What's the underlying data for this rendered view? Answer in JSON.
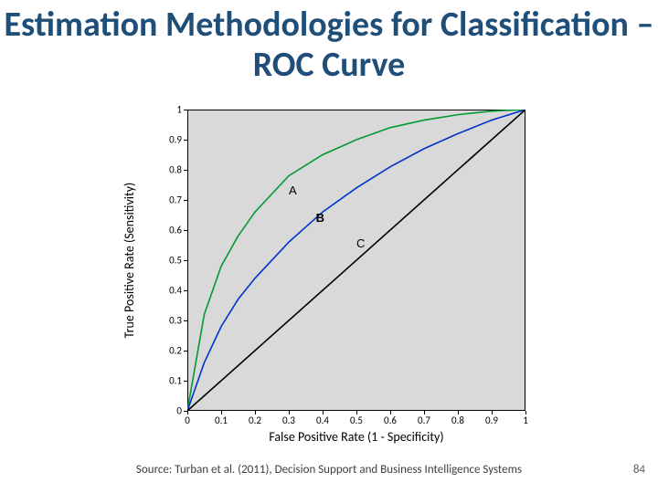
{
  "title": "Estimation Methodologies for Classification – ROC Curve",
  "source": "Source: Turban et al. (2011), Decision Support and Business Intelligence Systems",
  "page_number": "84",
  "chart_data": {
    "type": "line",
    "title": "",
    "xlabel": "False Positive Rate (1 - Specificity)",
    "ylabel": "True Positive Rate (Sensitivity)",
    "xlim": [
      0,
      1
    ],
    "ylim": [
      0,
      1
    ],
    "xticks": [
      0,
      0.1,
      0.2,
      0.3,
      0.4,
      0.5,
      0.6,
      0.7,
      0.8,
      0.9,
      1
    ],
    "yticks": [
      0,
      0.1,
      0.2,
      0.3,
      0.4,
      0.5,
      0.6,
      0.7,
      0.8,
      0.9,
      1
    ],
    "series": [
      {
        "name": "A",
        "color": "#009933",
        "label_pos": [
          0.3,
          0.73
        ],
        "x": [
          0,
          0.05,
          0.1,
          0.15,
          0.2,
          0.3,
          0.4,
          0.5,
          0.6,
          0.7,
          0.8,
          0.9,
          1.0
        ],
        "y": [
          0,
          0.32,
          0.48,
          0.58,
          0.66,
          0.78,
          0.85,
          0.9,
          0.94,
          0.965,
          0.983,
          0.995,
          1.0
        ]
      },
      {
        "name": "B",
        "color": "#0033cc",
        "label_pos": [
          0.38,
          0.64
        ],
        "x": [
          0,
          0.05,
          0.1,
          0.15,
          0.2,
          0.3,
          0.4,
          0.5,
          0.6,
          0.7,
          0.8,
          0.9,
          1.0
        ],
        "y": [
          0,
          0.16,
          0.28,
          0.37,
          0.44,
          0.56,
          0.66,
          0.74,
          0.81,
          0.87,
          0.92,
          0.965,
          1.0
        ]
      },
      {
        "name": "C",
        "color": "#000000",
        "label_pos": [
          0.5,
          0.555
        ],
        "x": [
          0,
          1.0
        ],
        "y": [
          0,
          1.0
        ]
      }
    ]
  }
}
